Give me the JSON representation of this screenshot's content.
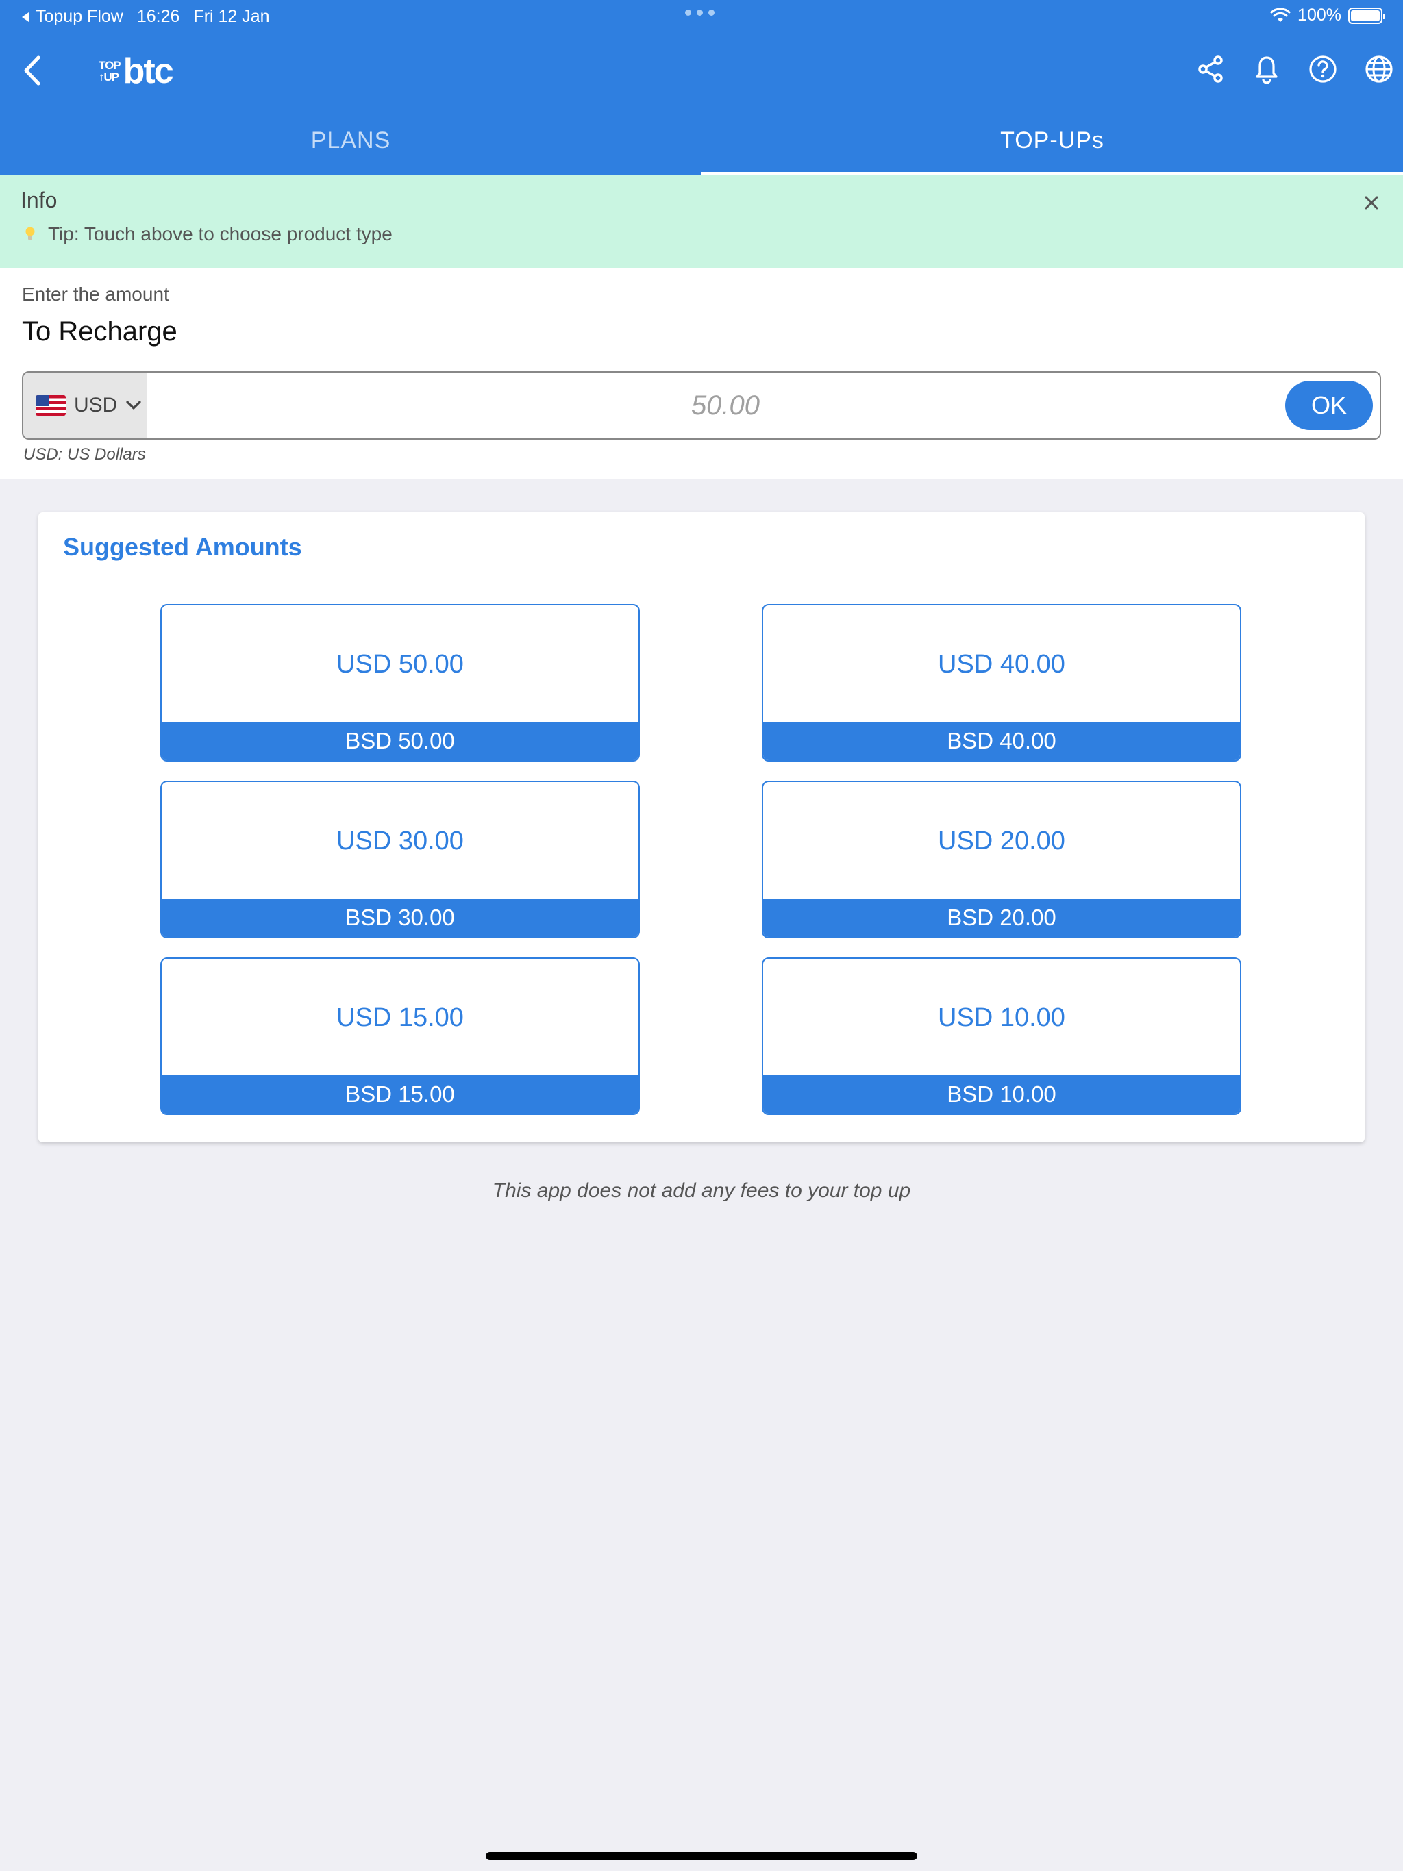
{
  "status_bar": {
    "back_app": "Topup Flow",
    "time": "16:26",
    "date": "Fri 12 Jan",
    "battery": "100%"
  },
  "navbar": {
    "logo_small_top": "TOP",
    "logo_small_bottom": "↑UP",
    "logo_big": "btc",
    "icons": [
      "share-icon",
      "bell-icon",
      "help-icon",
      "globe-icon"
    ]
  },
  "tabs": [
    {
      "label": "PLANS",
      "active": false
    },
    {
      "label": "TOP-UPs",
      "active": true
    }
  ],
  "info": {
    "title": "Info",
    "tip": "Tip: Touch above to choose product type"
  },
  "entry": {
    "label": "Enter the amount",
    "title": "To Recharge",
    "currency": "USD",
    "placeholder": "50.00",
    "ok_label": "OK",
    "hint": "USD: US Dollars"
  },
  "suggested": {
    "title": "Suggested Amounts",
    "amounts": [
      {
        "main": "USD 50.00",
        "sub": "BSD 50.00"
      },
      {
        "main": "USD 40.00",
        "sub": "BSD 40.00"
      },
      {
        "main": "USD 30.00",
        "sub": "BSD 30.00"
      },
      {
        "main": "USD 20.00",
        "sub": "BSD 20.00"
      },
      {
        "main": "USD 15.00",
        "sub": "BSD 15.00"
      },
      {
        "main": "USD 10.00",
        "sub": "BSD 10.00"
      }
    ]
  },
  "footer": {
    "note": "This app does not add any fees to your top up"
  },
  "colors": {
    "primary": "#2f7fe0",
    "info_bg": "#c9f5e1",
    "page_bg": "#efeff4"
  }
}
